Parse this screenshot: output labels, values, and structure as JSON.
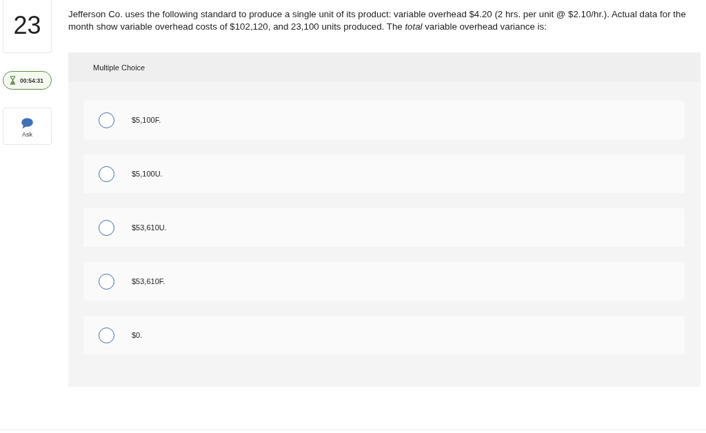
{
  "question": {
    "number": "23",
    "text": "Jefferson Co. uses the following standard to produce a single unit of its product: variable overhead $4.20 (2 hrs. per unit @ $2.10/hr.). Actual data for the month show variable overhead costs of $102,120, and 23,100 units produced. The *total* variable overhead variance is:"
  },
  "timer": {
    "time": "00:54:31"
  },
  "ask": {
    "label": "Ask"
  },
  "multiple_choice": {
    "title": "Multiple Choice",
    "options": [
      {
        "label": "$5,100F.",
        "selected": false
      },
      {
        "label": "$5,100U.",
        "selected": false
      },
      {
        "label": "$53,610U.",
        "selected": false
      },
      {
        "label": "$53,610F.",
        "selected": false
      },
      {
        "label": "$0.",
        "selected": false
      }
    ]
  }
}
